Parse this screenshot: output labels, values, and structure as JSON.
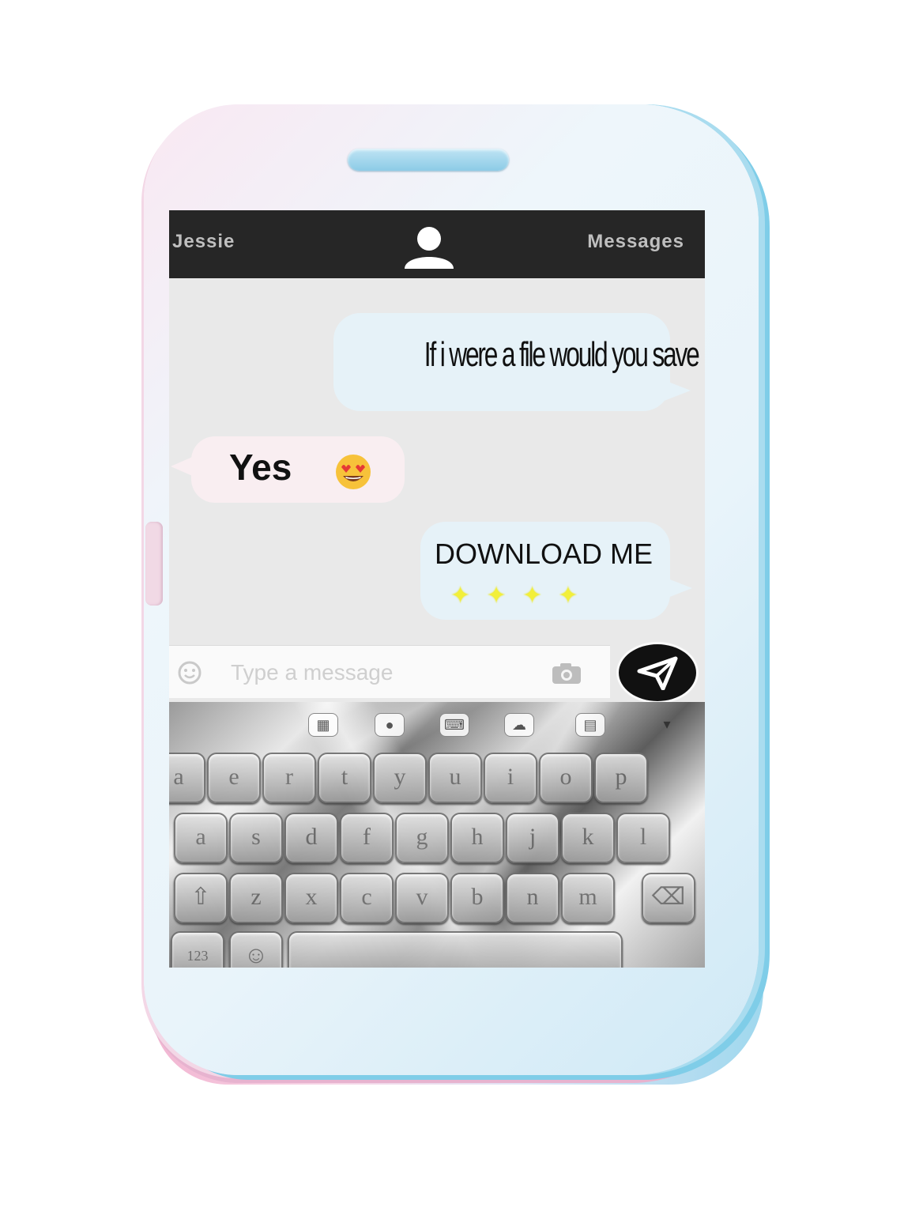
{
  "header": {
    "contact_name": "Jessie",
    "app_title": "Messages",
    "avatar_icon": "person-icon"
  },
  "conversation": {
    "outgoing_1": "If i were  a file would you save me,",
    "incoming_1": "Yes",
    "incoming_1_emoji": "heart-eyes-emoji",
    "outgoing_2": "DOWNLOAD  ME",
    "outgoing_2_sparkles": "✦ ✦ ✦ ✦"
  },
  "composer": {
    "placeholder": "Type a message",
    "emoji_icon": "smiley-icon",
    "camera_icon": "camera-icon",
    "send_icon": "send-icon"
  },
  "keyboard": {
    "toolbar_icons": [
      "grid-icon",
      "person-icon",
      "keyboard-icon",
      "theme-icon",
      "calendar-icon",
      "chevron-down-icon"
    ],
    "row1": [
      "a",
      "e",
      "r",
      "t",
      "y",
      "u",
      "i",
      "o",
      "p"
    ],
    "row2": [
      "a",
      "s",
      "d",
      "f",
      "g",
      "h",
      "j",
      "k",
      "l"
    ],
    "row3": [
      "⇧",
      "z",
      "x",
      "c",
      "v",
      "b",
      "n",
      "m",
      "⌫"
    ],
    "row4": [
      "123",
      "☺"
    ]
  },
  "colors": {
    "topbar": "#262626",
    "chat_background": "#e9e9e9",
    "outgoing_bubble": "#e6f2f8",
    "incoming_bubble": "#f9eef1",
    "sparkle": "#f2ef3a"
  }
}
